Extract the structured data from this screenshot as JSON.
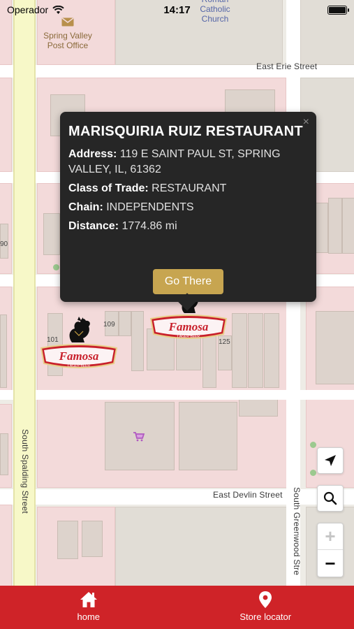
{
  "status_bar": {
    "carrier": "Operador",
    "time": "14:17"
  },
  "map": {
    "streets": {
      "east_erie": "East Erie Street",
      "east_devlin": "East Devlin Street",
      "south_spalding": "South Spalding Street",
      "south_greenwood": "South Greenwood Stre"
    },
    "pois": {
      "post_office": "Spring Valley Post Office",
      "church": "Roman Catholic Church"
    },
    "address_numbers": [
      "101",
      "109",
      "125",
      "90"
    ],
    "marker_brand": "Famosa",
    "marker_subtext": "LAGER BEER"
  },
  "popup": {
    "title": "MARISQUIRIA RUIZ RESTAURANT",
    "address_label": "Address:",
    "address_value": "119 E SAINT PAUL ST, SPRING VALLEY, IL, 61362",
    "class_label": "Class of Trade:",
    "class_value": "RESTAURANT",
    "chain_label": "Chain:",
    "chain_value": "INDEPENDENTS",
    "distance_label": "Distance:",
    "distance_value": "1774.86 mi",
    "button_label": "Go There",
    "close_symbol": "×"
  },
  "controls": {
    "zoom_in": "+",
    "zoom_out": "−"
  },
  "tabs": [
    {
      "label": "home",
      "icon": "home-icon"
    },
    {
      "label": "Store locator",
      "icon": "location-pin-icon"
    }
  ],
  "colors": {
    "tab_bar": "#cf2328",
    "popup_bg": "#262626",
    "button": "#c7a550"
  }
}
